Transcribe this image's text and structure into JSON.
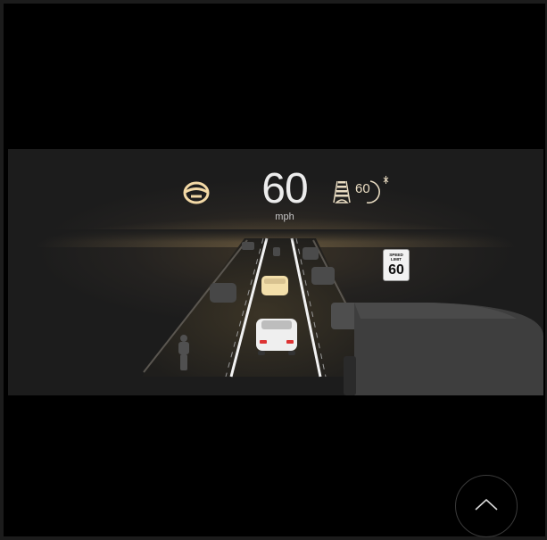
{
  "hud": {
    "speed": "60",
    "unit": "mph",
    "set_speed": "60",
    "steering_icon": "steering-wheel-icon",
    "adaptive_cruise_icon": "adaptive-cruise-icon"
  },
  "sign": {
    "top_text": "SPEED\nLIMIT",
    "value": "60"
  },
  "scroll_button": {
    "icon": "chevron-up-icon"
  },
  "colors": {
    "accent": "#f3d9a6",
    "ego_car": "#efefef",
    "lead_car": "#f3dfaa",
    "other_vehicles": "#4a4a4a"
  }
}
